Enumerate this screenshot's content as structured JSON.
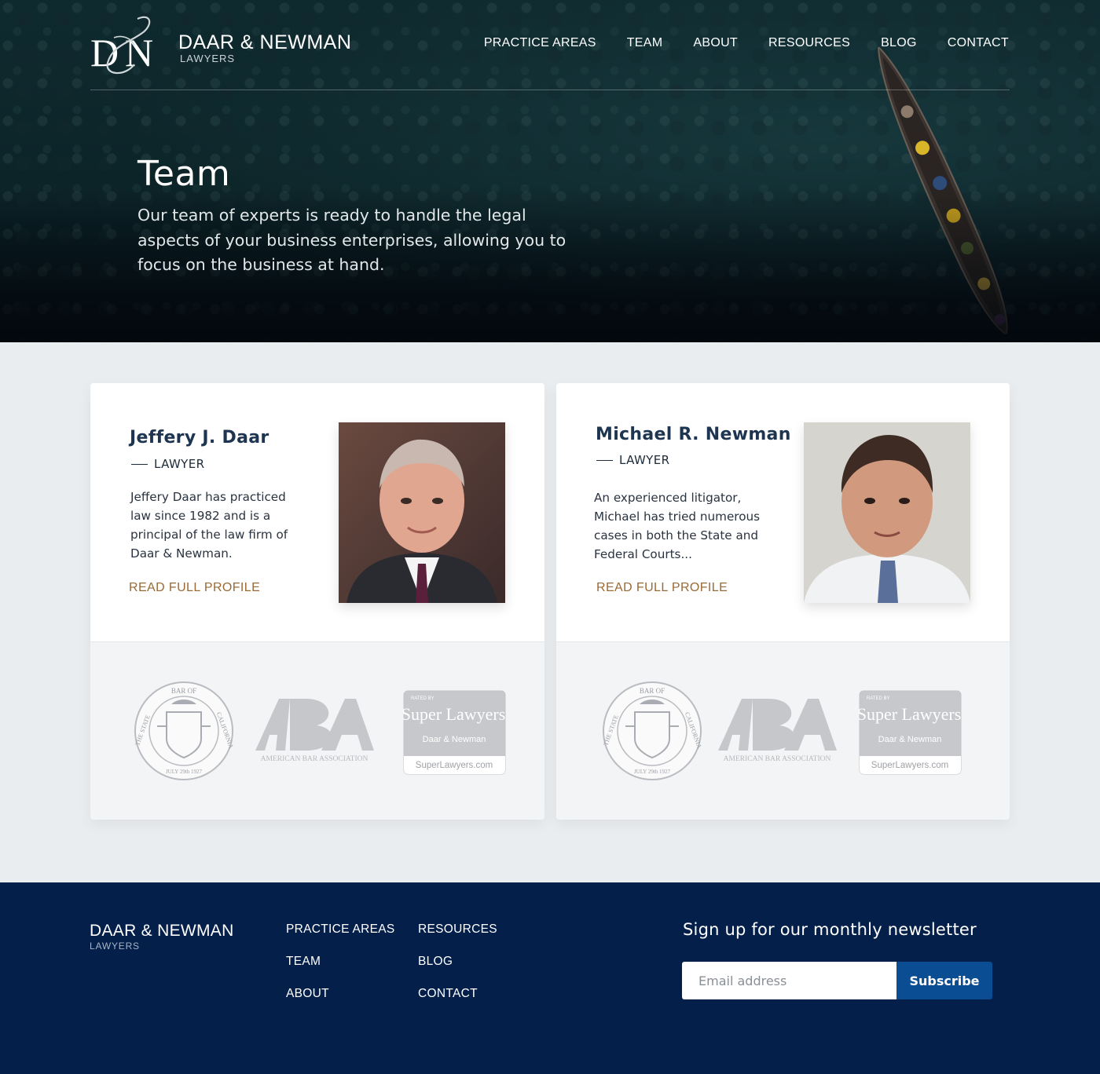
{
  "brand": {
    "name": "DAAR & NEWMAN",
    "subtitle": "LAWYERS",
    "monogram": "DN"
  },
  "nav": {
    "items": [
      "PRACTICE AREAS",
      "TEAM",
      "ABOUT",
      "RESOURCES",
      "BLOG",
      "CONTACT"
    ]
  },
  "hero": {
    "title": "Team",
    "description": "Our team of experts is ready to handle the legal aspects of your business enterprises, allowing you to focus on the business at hand."
  },
  "team": [
    {
      "name": "Jeffery J. Daar",
      "role": "LAWYER",
      "bio": "Jeffery Daar has practiced law since 1982 and is a principal of the law firm of Daar & Newman.",
      "link": "READ FULL PROFILE"
    },
    {
      "name": "Michael R. Newman",
      "role": "LAWYER",
      "bio": "An experienced litigator, Michael has tried numerous cases in both the State and Federal Courts...",
      "link": "READ FULL PROFILE"
    }
  ],
  "badges": {
    "state_bar": {
      "top": "BAR OF",
      "left": "THE STATE",
      "right": "CALIFORNIA",
      "date": "JULY 29th 1927"
    },
    "aba": {
      "mark": "ABA",
      "caption": "AMERICAN BAR ASSOCIATION"
    },
    "super_lawyers": {
      "rated_by": "RATED BY",
      "title": "Super Lawyers",
      "firm": "Daar & Newman",
      "url": "SuperLawyers.com"
    }
  },
  "footer": {
    "brand_name": "DAAR & NEWMAN",
    "brand_sub": "LAWYERS",
    "links_col1": [
      "PRACTICE AREAS",
      "TEAM",
      "ABOUT"
    ],
    "links_col2": [
      "RESOURCES",
      "BLOG",
      "CONTACT"
    ],
    "newsletter_title": "Sign up for our monthly newsletter",
    "email_placeholder": "Email address",
    "subscribe_label": "Subscribe"
  },
  "colors": {
    "footer_bg": "#04204a",
    "accent_link": "#9a6a35",
    "subscribe_bg": "#0b4d93"
  }
}
